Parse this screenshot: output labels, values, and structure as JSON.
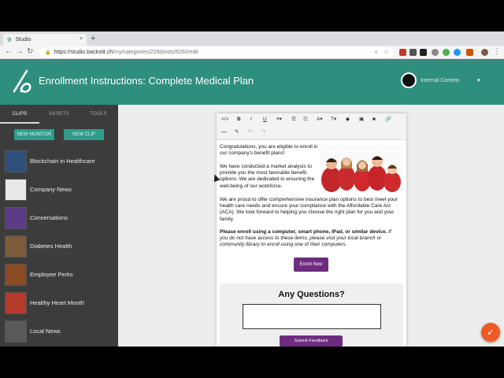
{
  "browser": {
    "tab_title": "Studio",
    "tab_close": "×",
    "new_tab": "+",
    "url_host": "https://studio.backstit.ch",
    "url_path": "/my/categories/229/posts/6260/edit"
  },
  "header": {
    "title": "Enrollment Instructions: Complete Medical Plan",
    "account_label": "Internal Comms",
    "brand_color": "#2f8f7e"
  },
  "sidebar": {
    "tabs": [
      "CLIPS",
      "ASSETS",
      "TOOLS"
    ],
    "new_monitor": "NEW MONITOR",
    "new_clip": "NEW CLIP",
    "clips": [
      {
        "label": "Blockchain in Healthcare",
        "thumb": "#2d4f7a"
      },
      {
        "label": "Company News",
        "thumb": "#e8e8e8"
      },
      {
        "label": "Conversations",
        "thumb": "#5d3a86"
      },
      {
        "label": "Diabetes Health",
        "thumb": "#7c5c3a"
      },
      {
        "label": "Employee Perks",
        "thumb": "#8a4a24"
      },
      {
        "label": "Healthy Heart Month",
        "thumb": "#b43a2a"
      },
      {
        "label": "Local News",
        "thumb": "#5a5a5a"
      }
    ]
  },
  "editor": {
    "toolbar": [
      "</>",
      "B",
      "I",
      "U",
      "≡▾",
      "☰",
      "☷",
      "A▾",
      "T▾",
      "◆",
      "▣",
      "■",
      "🔗",
      "—",
      "✎",
      "↶",
      "↷"
    ],
    "para1": "Congratulations, you are eligible to enroll in our company's benefit plans!",
    "para2": "We have conducted a market analysis to provide you the most favorable benefit options. We are dedicated to ensuring the well-being of our workforce.",
    "para3": "We are proud to offer comprehensive insurance plan options to best meet your health care needs and ensure your compliance with the Affordable Care Act (ACA). We look forward to helping you choose the right plan for you and your family.",
    "para4_bold": "Please enroll using a computer, smart phone, iPad, or similar device.",
    "para4_italic": " If you do not have access to these items, please visit your local branch or community library to enroll using one of their computers.",
    "enroll_button": "Enroll Now",
    "questions_title": "Any Questions?",
    "submit_button": "Submit Feedback",
    "accent_color": "#6d2c80"
  },
  "fab_icon": "✓"
}
